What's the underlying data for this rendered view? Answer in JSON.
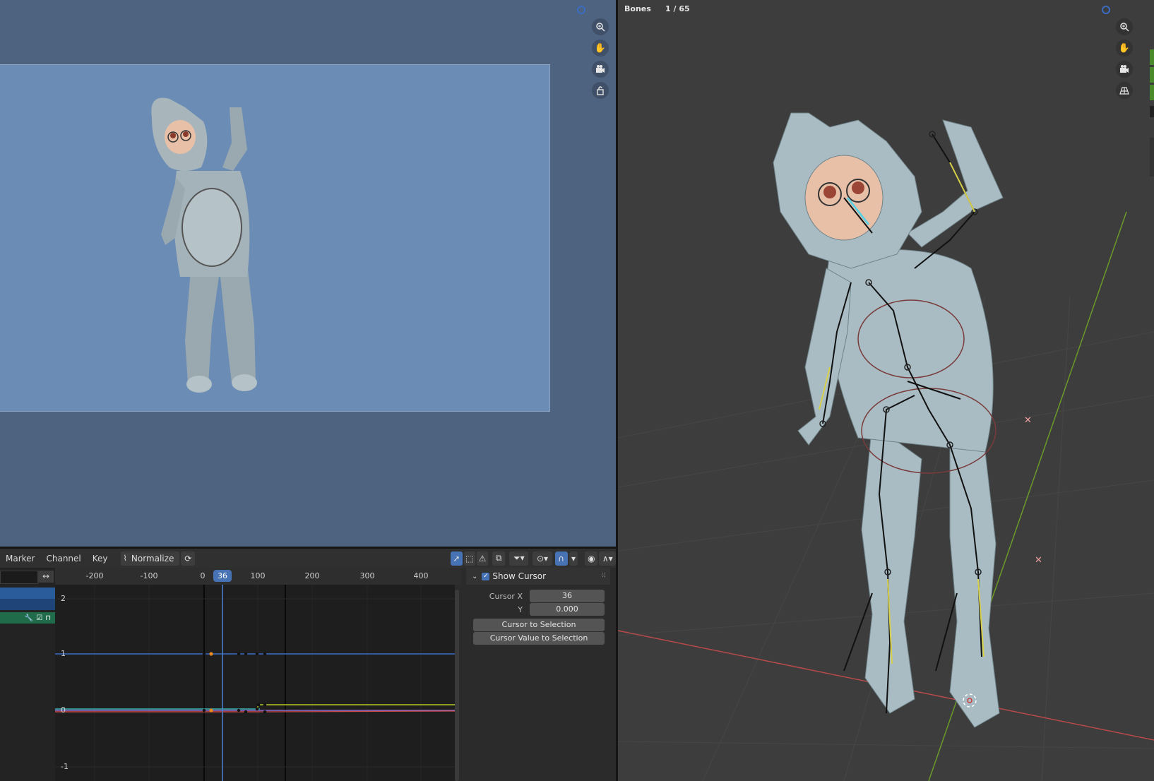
{
  "graph_editor": {
    "menu": [
      "Marker",
      "Channel",
      "Key"
    ],
    "normalize_label": "Normalize",
    "ruler_ticks": [
      "-200",
      "-100",
      "0",
      "100",
      "200",
      "300",
      "400"
    ],
    "current_frame": "36",
    "y_labels": [
      "2",
      "1",
      "0",
      "-1"
    ],
    "sidebar": {
      "show_cursor_label": "Show Cursor",
      "cursor_x_label": "Cursor X",
      "cursor_x_value": "36",
      "cursor_y_label": "Y",
      "cursor_y_value": "0.000",
      "cursor_to_selection": "Cursor to Selection",
      "cursor_value_to_selection": "Cursor Value to Selection"
    }
  },
  "viewport3d": {
    "bones_label": "Bones",
    "bones_count": "1 / 65"
  },
  "icons": {
    "zoom": "zoom-in-icon",
    "pan": "hand-pan-icon",
    "camera": "camera-view-icon",
    "lock": "lock-icon",
    "ortho": "ortho-grid-icon"
  },
  "colors": {
    "accent": "#4772b3",
    "selected_bone": "#5fd0e0",
    "curve_yellow": "#b5c926",
    "curve_red": "#c94b4b",
    "curve_teal": "#3ab0b0",
    "curve_purple": "#8f6fd0",
    "x_axis": "#b84a4a",
    "y_axis": "#6b9a2a"
  }
}
